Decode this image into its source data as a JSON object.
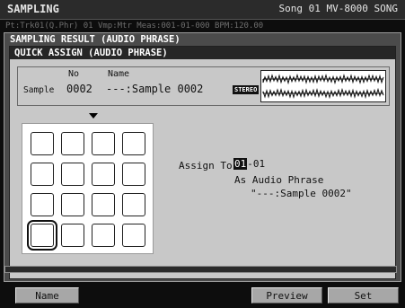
{
  "topbar": {
    "title": "SAMPLING",
    "song": "Song 01 MV-8000 SONG"
  },
  "subinfo": {
    "text": "Pt:Trk01(Q.Phr) 01 Vmp:Mtr  Meas:001-01-000  BPM:120.00"
  },
  "outer_dialog": {
    "title": "SAMPLING RESULT (AUDIO PHRASE)"
  },
  "inner_dialog": {
    "title": "QUICK ASSIGN (AUDIO PHRASE)"
  },
  "sample": {
    "label": "Sample",
    "no_header": "No",
    "name_header": "Name",
    "no": "0002",
    "name": "---:Sample  0002",
    "stereo_badge": "STEREO"
  },
  "pads": {
    "rows": 4,
    "cols": 4,
    "selected_index": 12
  },
  "assign": {
    "label": "Assign To",
    "value_highlight": "01",
    "value_rest": "-01",
    "as_label": "As Audio Phrase",
    "phrase_name": "\"---:Sample  0002\""
  },
  "function_buttons": {
    "name": "Name",
    "preview": "Preview",
    "set": "Set"
  }
}
